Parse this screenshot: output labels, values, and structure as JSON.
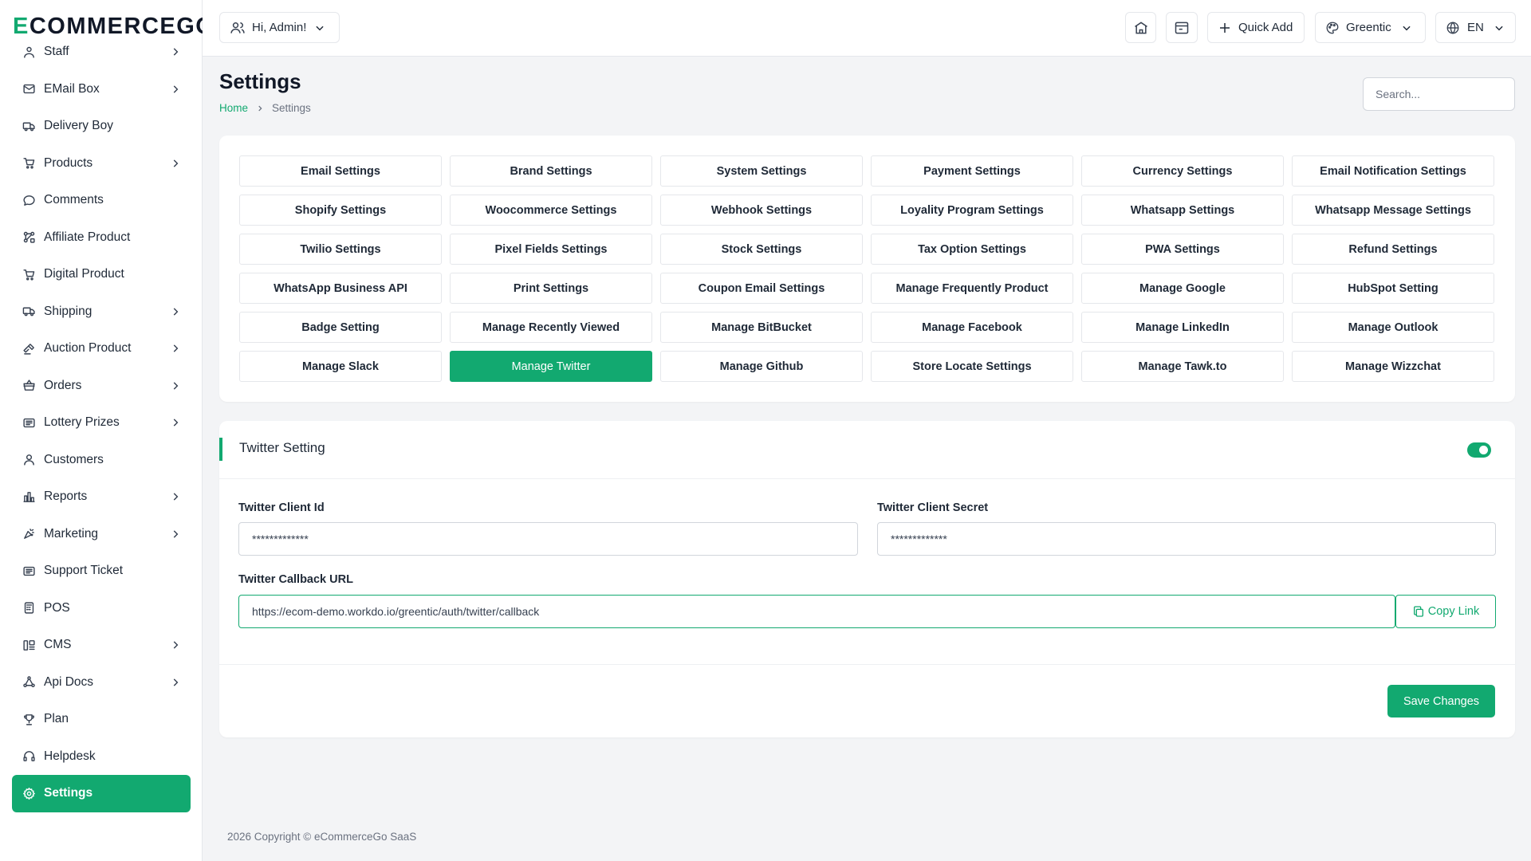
{
  "brand": {
    "logo_first": "E",
    "logo_rest": "COMMERCEGO",
    "accent": "#12a970"
  },
  "sidebar": {
    "items": [
      {
        "label": "Staff",
        "icon": "staff-icon",
        "chevron": true
      },
      {
        "label": "EMail Box",
        "icon": "mail-icon",
        "chevron": true
      },
      {
        "label": "Delivery Boy",
        "icon": "truck-icon",
        "chevron": false
      },
      {
        "label": "Products",
        "icon": "cart-icon",
        "chevron": true
      },
      {
        "label": "Comments",
        "icon": "comment-icon",
        "chevron": false
      },
      {
        "label": "Affiliate Product",
        "icon": "affiliate-icon",
        "chevron": false
      },
      {
        "label": "Digital Product",
        "icon": "cart-icon",
        "chevron": false
      },
      {
        "label": "Shipping",
        "icon": "truck-icon",
        "chevron": true
      },
      {
        "label": "Auction Product",
        "icon": "auction-icon",
        "chevron": true
      },
      {
        "label": "Orders",
        "icon": "basket-icon",
        "chevron": true
      },
      {
        "label": "Lottery Prizes",
        "icon": "ticket-icon",
        "chevron": true
      },
      {
        "label": "Customers",
        "icon": "user-icon",
        "chevron": false
      },
      {
        "label": "Reports",
        "icon": "chart-icon",
        "chevron": true
      },
      {
        "label": "Marketing",
        "icon": "marketing-icon",
        "chevron": true
      },
      {
        "label": "Support Ticket",
        "icon": "ticket-icon",
        "chevron": false
      },
      {
        "label": "POS",
        "icon": "pos-icon",
        "chevron": false
      },
      {
        "label": "CMS",
        "icon": "cms-icon",
        "chevron": true
      },
      {
        "label": "Api Docs",
        "icon": "api-icon",
        "chevron": true
      },
      {
        "label": "Plan",
        "icon": "trophy-icon",
        "chevron": false
      },
      {
        "label": "Helpdesk",
        "icon": "headset-icon",
        "chevron": false
      },
      {
        "label": "Settings",
        "icon": "gear-icon",
        "chevron": false,
        "active": true
      }
    ]
  },
  "topbar": {
    "user_greeting": "Hi, Admin!",
    "quick_add": "Quick Add",
    "theme": "Greentic",
    "language": "EN"
  },
  "page": {
    "title": "Settings",
    "breadcrumb": {
      "home": "Home",
      "current": "Settings"
    },
    "search_placeholder": "Search..."
  },
  "settings_tabs": [
    "Email Settings",
    "Brand Settings",
    "System Settings",
    "Payment Settings",
    "Currency Settings",
    "Email Notification Settings",
    "Shopify Settings",
    "Woocommerce Settings",
    "Webhook Settings",
    "Loyality Program Settings",
    "Whatsapp Settings",
    "Whatsapp Message Settings",
    "Twilio Settings",
    "Pixel Fields Settings",
    "Stock Settings",
    "Tax Option Settings",
    "PWA Settings",
    "Refund Settings",
    "WhatsApp Business API",
    "Print Settings",
    "Coupon Email Settings",
    "Manage Frequently Product",
    "Manage Google",
    "HubSpot Setting",
    "Badge Setting",
    "Manage Recently Viewed",
    "Manage BitBucket",
    "Manage Facebook",
    "Manage LinkedIn",
    "Manage Outlook",
    "Manage Slack",
    "Manage Twitter",
    "Manage Github",
    "Store Locate Settings",
    "Manage Tawk.to",
    "Manage Wizzchat"
  ],
  "active_tab": "Manage Twitter",
  "twitter_form": {
    "title": "Twitter Setting",
    "enabled": true,
    "client_id_label": "Twitter Client Id",
    "client_id_value": "*************",
    "client_secret_label": "Twitter Client Secret",
    "client_secret_value": "*************",
    "callback_label": "Twitter Callback URL",
    "callback_value": "https://ecom-demo.workdo.io/greentic/auth/twitter/callback",
    "copy_label": "Copy Link",
    "save_label": "Save Changes"
  },
  "footer": {
    "text": "2026 Copyright © eCommerceGo SaaS"
  }
}
